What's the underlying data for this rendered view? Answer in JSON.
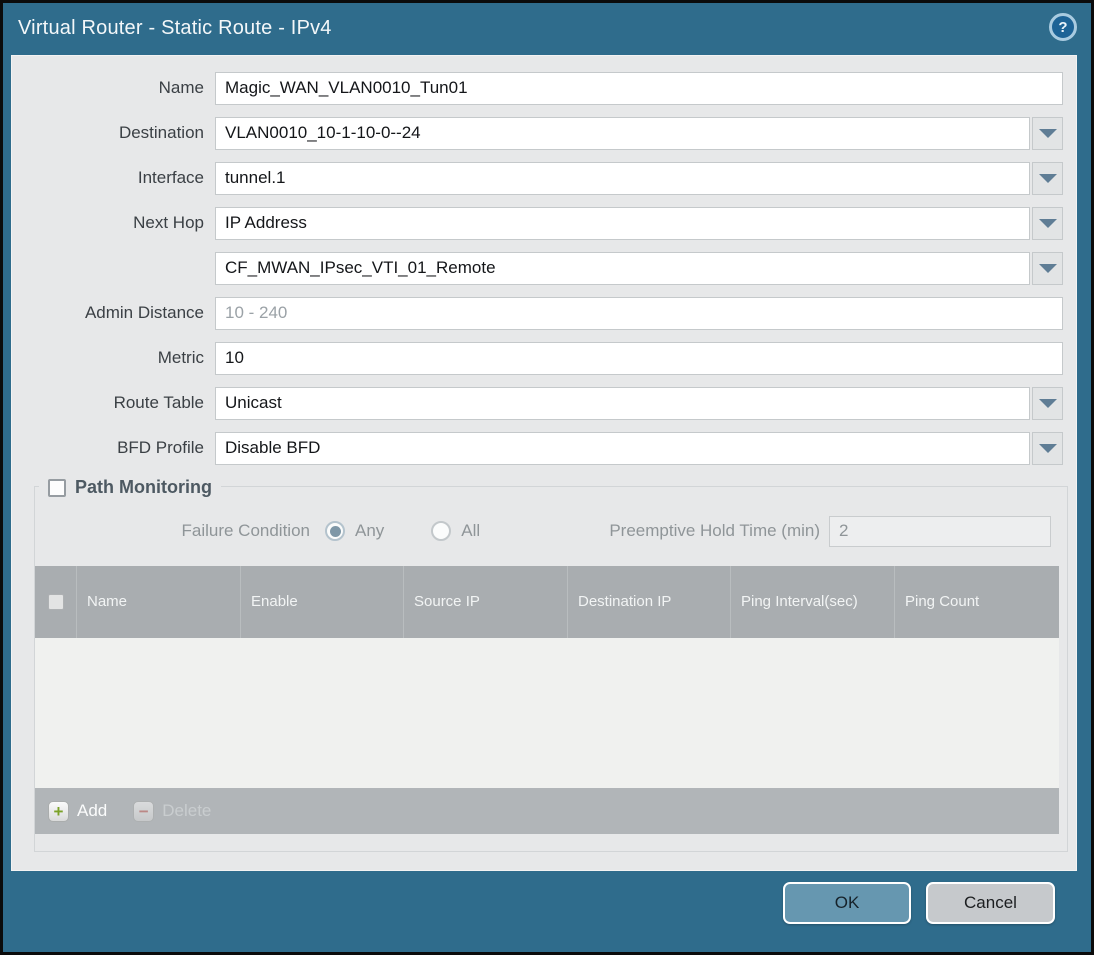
{
  "titlebar": {
    "title": "Virtual Router - Static Route - IPv4",
    "help_icon": "?"
  },
  "form": {
    "name": {
      "label": "Name",
      "value": "Magic_WAN_VLAN0010_Tun01"
    },
    "destination": {
      "label": "Destination",
      "value": "VLAN0010_10-1-10-0--24"
    },
    "interface": {
      "label": "Interface",
      "value": "tunnel.1"
    },
    "next_hop": {
      "label": "Next Hop",
      "value": "IP Address"
    },
    "next_hop_address": {
      "value": "CF_MWAN_IPsec_VTI_01_Remote"
    },
    "admin_distance": {
      "label": "Admin Distance",
      "value": "",
      "placeholder": "10 - 240"
    },
    "metric": {
      "label": "Metric",
      "value": "10"
    },
    "route_table": {
      "label": "Route Table",
      "value": "Unicast"
    },
    "bfd_profile": {
      "label": "BFD Profile",
      "value": "Disable BFD"
    }
  },
  "path_monitoring": {
    "title": "Path Monitoring",
    "enabled": false,
    "failure_condition": {
      "label": "Failure Condition",
      "options": [
        {
          "label": "Any",
          "selected": true
        },
        {
          "label": "All",
          "selected": false
        }
      ]
    },
    "preemptive_hold_time": {
      "label": "Preemptive Hold Time (min)",
      "value": "2"
    },
    "table": {
      "columns": [
        "Name",
        "Enable",
        "Source IP",
        "Destination IP",
        "Ping Interval(sec)",
        "Ping Count"
      ],
      "rows": [],
      "add_label": "Add",
      "delete_label": "Delete"
    }
  },
  "footer": {
    "ok_label": "OK",
    "cancel_label": "Cancel"
  },
  "colors": {
    "titlebar_teal": "#2F6C8C",
    "panel_bg": "#E7E8E9",
    "table_header_bg": "#A9ADB0",
    "ok_button": "#6697B0",
    "cancel_button": "#C6C9CC",
    "dropdown_arrow": "#5F7D95",
    "add_icon_green": "#7BA228",
    "delete_icon_red": "#C4645E"
  }
}
